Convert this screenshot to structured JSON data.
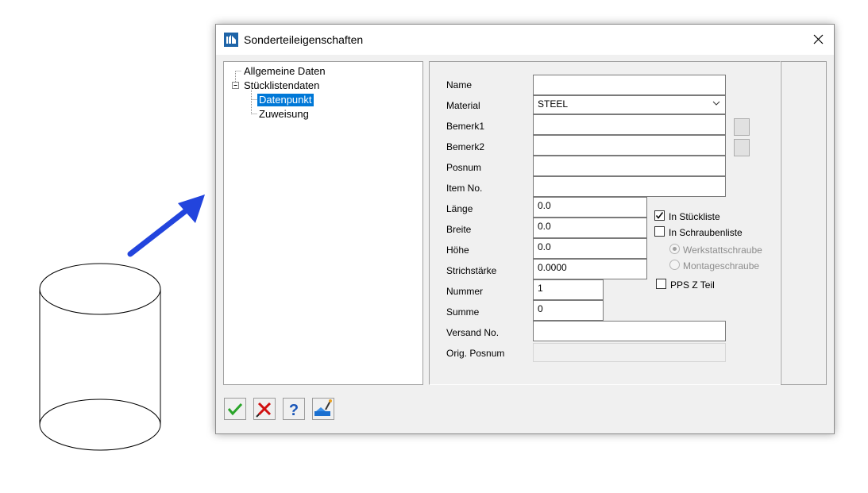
{
  "dialog": {
    "title": "Sonderteileigenschaften",
    "icons": {
      "app": "app-logo-icon",
      "close": "close-icon"
    }
  },
  "tree": {
    "items": [
      {
        "label": "Allgemeine Daten",
        "selected": false
      },
      {
        "label": "Stücklistendaten",
        "selected": false,
        "expanded": true
      },
      {
        "label": "Datenpunkt",
        "selected": true
      },
      {
        "label": "Zuweisung",
        "selected": false
      }
    ]
  },
  "form": {
    "name": {
      "label": "Name",
      "value": ""
    },
    "material": {
      "label": "Material",
      "value": "STEEL"
    },
    "bemerk1": {
      "label": "Bemerk1",
      "value": ""
    },
    "bemerk2": {
      "label": "Bemerk2",
      "value": ""
    },
    "posnum": {
      "label": "Posnum",
      "value": ""
    },
    "item_no": {
      "label": "Item No.",
      "value": ""
    },
    "laenge": {
      "label": "Länge",
      "value": "0.0"
    },
    "breite": {
      "label": "Breite",
      "value": "0.0"
    },
    "hoehe": {
      "label": "Höhe",
      "value": "0.0"
    },
    "strichstaerke": {
      "label": "Strichstärke",
      "value": "0.0000"
    },
    "nummer": {
      "label": "Nummer",
      "value": "1"
    },
    "summe": {
      "label": "Summe",
      "value": "0"
    },
    "versand_no": {
      "label": "Versand No.",
      "value": ""
    },
    "orig_posnum": {
      "label": "Orig. Posnum",
      "value": ""
    }
  },
  "options": {
    "in_stueckliste": {
      "label": "In Stückliste",
      "checked": true
    },
    "in_schraubenliste": {
      "label": "In Schraubenliste",
      "checked": false
    },
    "werkstattschraube": {
      "label": "Werkstattschraube",
      "selected": true,
      "disabled": true
    },
    "montageschraube": {
      "label": "Montageschraube",
      "selected": false,
      "disabled": true
    },
    "pps_z_teil": {
      "label": "PPS Z Teil",
      "checked": false
    }
  },
  "buttons": {
    "ok": "checkmark-icon",
    "cancel": "cross-icon",
    "help": "question-mark-icon",
    "pick": "pick-tool-icon"
  },
  "colors": {
    "selection": "#0078d7",
    "arrow": "#2244dd",
    "ok_green": "#2aa52a",
    "cancel_red": "#d01010",
    "help_blue": "#1a56b8"
  }
}
